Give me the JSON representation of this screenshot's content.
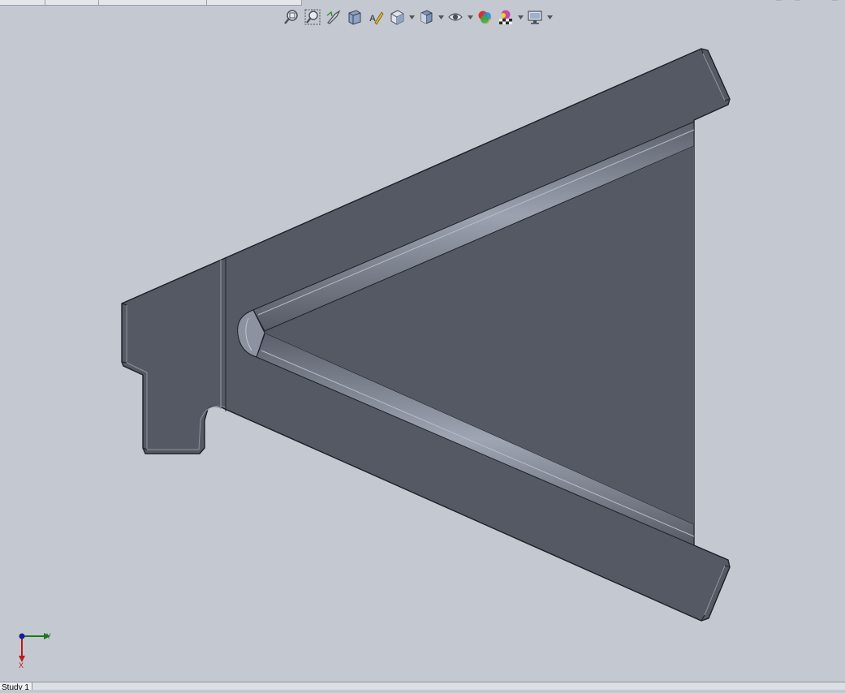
{
  "hud_toolbar": {
    "tools": [
      {
        "icon": "zoom-to-fit-icon"
      },
      {
        "icon": "zoom-to-area-icon"
      },
      {
        "icon": "previous-view-icon"
      },
      {
        "icon": "section-view-icon"
      },
      {
        "icon": "dynamic-annotation-icon"
      },
      {
        "icon": "view-orientation-icon",
        "has_dropdown": true
      },
      {
        "icon": "display-style-icon",
        "has_dropdown": true
      },
      {
        "icon": "hide-show-items-icon",
        "has_dropdown": true
      },
      {
        "icon": "edit-appearance-icon"
      },
      {
        "icon": "apply-scene-icon",
        "has_dropdown": true
      },
      {
        "icon": "view-settings-icon",
        "has_dropdown": true
      }
    ]
  },
  "triad": {
    "y_label": "Y",
    "x_label": "X"
  },
  "status_bar": {
    "active_tab": "Study 1"
  },
  "colors": {
    "background": "#c4c8d1",
    "part_face": "#555963",
    "part_edge": "#1e2026",
    "triad_y": "#1a7a1a",
    "triad_x": "#c01818",
    "triad_origin": "#1a1aa0"
  }
}
